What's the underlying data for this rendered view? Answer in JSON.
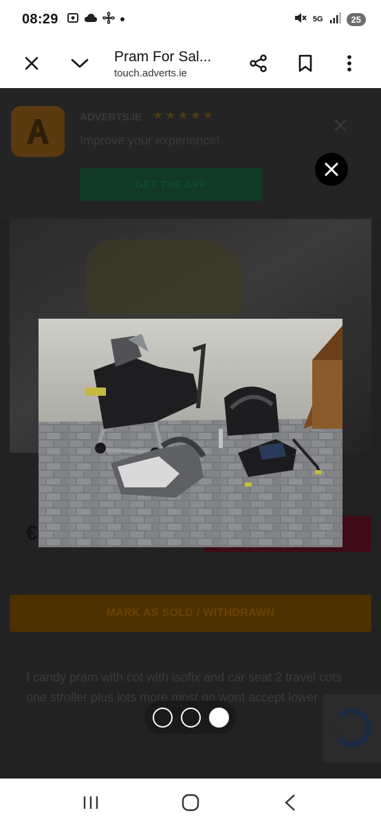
{
  "status": {
    "time": "08:29",
    "network": "5G",
    "battery": "25",
    "icons": [
      "screenshot-icon",
      "cloud-icon",
      "fan-icon",
      "dot-icon",
      "mute-icon",
      "signal-icon"
    ]
  },
  "tab": {
    "title": "Pram For Sal...",
    "url": "touch.adverts.ie",
    "buttons": [
      "close-icon",
      "chevron-down-icon",
      "share-icon",
      "bookmark-icon",
      "more-vert-icon"
    ]
  },
  "app_banner": {
    "app_name": "ADVERTS.IE",
    "stars": "★★★★★",
    "tagline": "Improve your experience!",
    "cta": "GET THE APP"
  },
  "listing": {
    "price_prefix": "€",
    "mark_sold_label": "MARK AS SOLD / WITHDRAWN",
    "description": "I candy pram with cot with isofix and car seat 2 travel cots one stroller plus lots more most go wont accept lower"
  },
  "viewer": {
    "image_count": 3,
    "active_index": 2
  },
  "nav": {
    "buttons": [
      "recent-apps-icon",
      "home-icon",
      "back-icon"
    ]
  },
  "colors": {
    "overlay": "#222222",
    "mark_sold": "#4d3000",
    "get_app": "#103a24"
  }
}
